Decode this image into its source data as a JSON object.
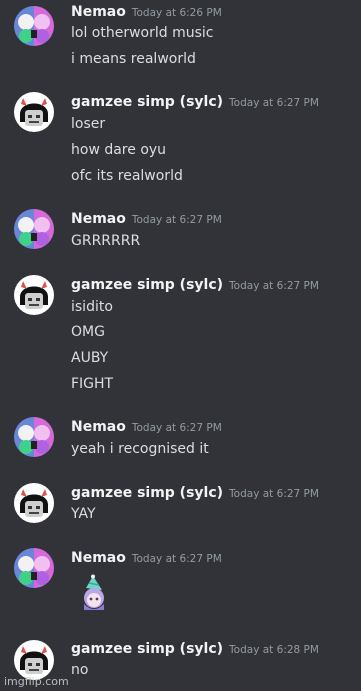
{
  "messages": [
    {
      "author": "Nemao",
      "timestamp": "Today at 6:26 PM",
      "lines": [
        "lol otherworld music",
        "i means realworld"
      ]
    },
    {
      "author": "gamzee simp (sylc)",
      "timestamp": "Today at 6:27 PM",
      "lines": [
        "loser",
        "how dare oyu",
        "ofc its realworld"
      ]
    },
    {
      "author": "Nemao",
      "timestamp": "Today at 6:27 PM",
      "lines": [
        "GRRRRRR"
      ]
    },
    {
      "author": "gamzee simp (sylc)",
      "timestamp": "Today at 6:27 PM",
      "lines": [
        "isidito",
        "OMG",
        "AUBY",
        "FIGHT"
      ]
    },
    {
      "author": "Nemao",
      "timestamp": "Today at 6:27 PM",
      "lines": [
        "yeah i recognised it"
      ]
    },
    {
      "author": "gamzee simp (sylc)",
      "timestamp": "Today at 6:27 PM",
      "lines": [
        "YAY"
      ]
    },
    {
      "author": "Nemao",
      "timestamp": "Today at 6:27 PM",
      "lines": [],
      "emoji": "party-hat-emoji"
    },
    {
      "author": "gamzee simp (sylc)",
      "timestamp": "Today at 6:28 PM",
      "lines": [
        "no"
      ]
    }
  ],
  "watermark": "imgflip.com",
  "colors": {
    "background": "#313338",
    "author": "#f2f3f5",
    "text": "#dbdee1",
    "timestamp": "#949ba4"
  }
}
